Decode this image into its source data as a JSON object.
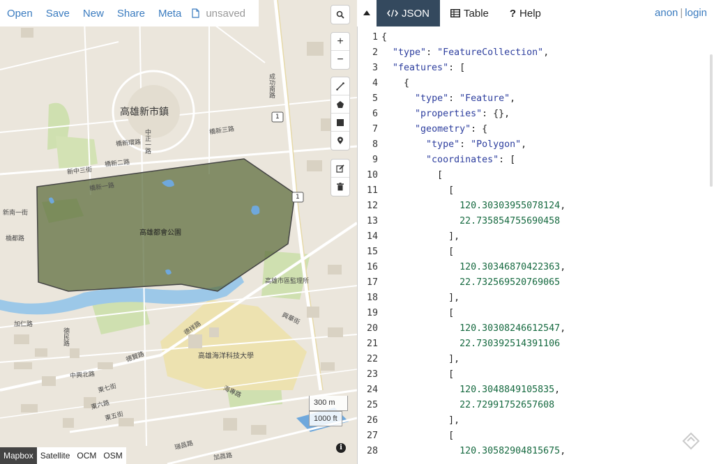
{
  "menu": {
    "items": [
      "Open",
      "Save",
      "New",
      "Share",
      "Meta"
    ],
    "file_status": "unsaved"
  },
  "map": {
    "labels": {
      "town": "高雄新市鎮",
      "park": "高雄都會公園",
      "university": "高雄海洋科技大學",
      "prison": "高雄市區監理所",
      "r1": "橋新一路",
      "r2": "橋新二路",
      "r3": "橋新三路",
      "r4": "橋新環路",
      "r5": "新中三街",
      "r6": "新南一街",
      "r7": "橋都路",
      "r8": "德祥路",
      "r9": "海專路",
      "r10": "中興北路",
      "r11": "成功南路",
      "r12": "加仁路",
      "r13": "德民路",
      "r14": "加昌路",
      "r15": "中正一路",
      "r16": "德賢路",
      "r17": "東七街",
      "r18": "東六路",
      "r19": "東五街",
      "r20": "瑞昌路",
      "r21": "興華街",
      "hw1": "1",
      "hw2": "1"
    },
    "scale_metric": "300 m",
    "scale_imperial": "1000 ft",
    "layers": [
      "Mapbox",
      "Satellite",
      "OCM",
      "OSM"
    ],
    "active_layer": "Mapbox",
    "polygon_fill": "#5a6b3a"
  },
  "tabs": [
    {
      "label": "JSON",
      "icon": "code-icon"
    },
    {
      "label": "Table",
      "icon": "table-icon"
    },
    {
      "label": "Help",
      "icon": "question-icon"
    }
  ],
  "active_tab": "JSON",
  "user": {
    "anon": "anon",
    "separator": "|",
    "login": "login"
  },
  "editor": {
    "line_numbers": [
      "1",
      "2",
      "3",
      "4",
      "5",
      "6",
      "7",
      "8",
      "9",
      "10",
      "11",
      "12",
      "13",
      "14",
      "15",
      "16",
      "17",
      "18",
      "19",
      "20",
      "21",
      "22",
      "23",
      "24",
      "25",
      "26",
      "27",
      "28"
    ],
    "lines": [
      "{",
      "  \"type\": \"FeatureCollection\",",
      "  \"features\": [",
      "    {",
      "      \"type\": \"Feature\",",
      "      \"properties\": {},",
      "      \"geometry\": {",
      "        \"type\": \"Polygon\",",
      "        \"coordinates\": [",
      "          [",
      "            [",
      "              120.30303955078124,",
      "              22.735854755690458",
      "            ],",
      "            [",
      "              120.30346870422363,",
      "              22.732569520769065",
      "            ],",
      "            [",
      "              120.30308246612547,",
      "              22.730392514391106",
      "            ],",
      "            [",
      "              120.3048849105835,",
      "              22.72991752657608",
      "            ],",
      "            [",
      "              120.30582904815675,"
    ]
  },
  "colors": {
    "accent": "#3a7bbf",
    "active_tab_bg": "#34495e",
    "string": "#2d3e9e",
    "number": "#15693f"
  }
}
